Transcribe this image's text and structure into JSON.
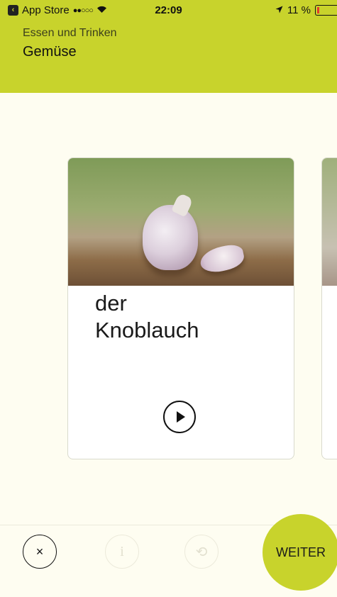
{
  "status_bar": {
    "back_app": "App Store",
    "signal": "●●○○○",
    "time": "22:09",
    "battery": "11 %"
  },
  "header": {
    "category": "Essen und Trinken",
    "subcategory": "Gemüse"
  },
  "card": {
    "article": "der",
    "noun": "Knoblauch",
    "image_subject": "garlic bulb and clove"
  },
  "bottom_bar": {
    "close_glyph": "×",
    "info_glyph": "i",
    "undo_glyph": "⟲",
    "next_label": "WEITER"
  },
  "colors": {
    "accent": "#c8d32c",
    "background": "#fefdf1",
    "card": "#ffffff",
    "disabled": "#e2e0cf"
  },
  "icons": {
    "close": "close-icon",
    "info": "info-icon",
    "undo": "undo-icon",
    "play": "play-icon",
    "location": "location-arrow-icon",
    "wifi": "wifi-icon",
    "battery": "battery-icon"
  }
}
